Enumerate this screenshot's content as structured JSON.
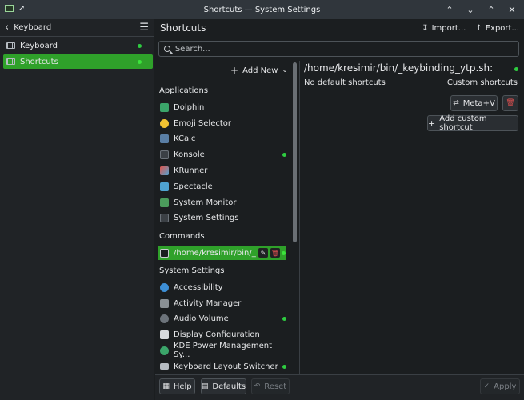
{
  "window": {
    "title": "Shortcuts — System Settings",
    "left_icons": [
      "app-icon",
      "pin-icon"
    ],
    "controls": [
      "keep-above-icon",
      "minimize-icon",
      "maximize-icon",
      "close-icon"
    ]
  },
  "sidebar": {
    "back_label": "Keyboard",
    "items": [
      {
        "label": "Keyboard",
        "selected": false,
        "modified": true
      },
      {
        "label": "Shortcuts",
        "selected": true,
        "modified": true
      }
    ]
  },
  "header": {
    "title": "Shortcuts",
    "import_label": "Import...",
    "export_label": "Export..."
  },
  "search": {
    "placeholder": "Search..."
  },
  "list": {
    "add_new_label": "Add New",
    "sections": [
      {
        "heading": "Applications",
        "items": [
          {
            "label": "Dolphin",
            "icon": "dolphin-icon",
            "color": "#3ba56a"
          },
          {
            "label": "Emoji Selector",
            "icon": "emoji-icon",
            "color": "#f1c232"
          },
          {
            "label": "KCalc",
            "icon": "kcalc-icon",
            "color": "#5a7fa6"
          },
          {
            "label": "Konsole",
            "icon": "konsole-icon",
            "color": "#3b4045",
            "modified": true
          },
          {
            "label": "KRunner",
            "icon": "krunner-icon",
            "color": "#e0554c"
          },
          {
            "label": "Spectacle",
            "icon": "spectacle-icon",
            "color": "#4fa3d1"
          },
          {
            "label": "System Monitor",
            "icon": "system-monitor-icon",
            "color": "#4b9b5c"
          },
          {
            "label": "System Settings",
            "icon": "system-settings-icon",
            "color": "#3b4045"
          }
        ]
      },
      {
        "heading": "Commands",
        "items": [
          {
            "label": "/home/kresimir/bin/_...",
            "icon": "command-icon",
            "color": "#1b1e20",
            "selected": true,
            "modified": true
          }
        ]
      },
      {
        "heading": "System Settings",
        "items": [
          {
            "label": "Accessibility",
            "icon": "accessibility-icon",
            "color": "#3d8fd6"
          },
          {
            "label": "Activity Manager",
            "icon": "activity-manager-icon",
            "color": "#8a9095"
          },
          {
            "label": "Audio Volume",
            "icon": "audio-volume-icon",
            "color": "#6c737a",
            "modified": true
          },
          {
            "label": "Display Configuration",
            "icon": "display-icon",
            "color": "#d7dadd"
          },
          {
            "label": "KDE Power Management Sy...",
            "icon": "power-icon",
            "color": "#3ba56a"
          },
          {
            "label": "Keyboard Layout Switcher",
            "icon": "keyboard-icon",
            "color": "#b6bcc2",
            "modified": true
          }
        ]
      }
    ]
  },
  "detail": {
    "title": "/home/kresimir/bin/_keybinding_ytp.sh:",
    "no_default": "No default shortcuts",
    "custom_heading": "Custom shortcuts",
    "shortcut": "Meta+V",
    "add_custom_label": "Add custom shortcut"
  },
  "footer": {
    "help_label": "Help",
    "defaults_label": "Defaults",
    "reset_label": "Reset",
    "apply_label": "Apply"
  },
  "colors": {
    "accent": "#2fa12a",
    "modified_dot": "#2ecc40",
    "background": "#1b1e20"
  }
}
